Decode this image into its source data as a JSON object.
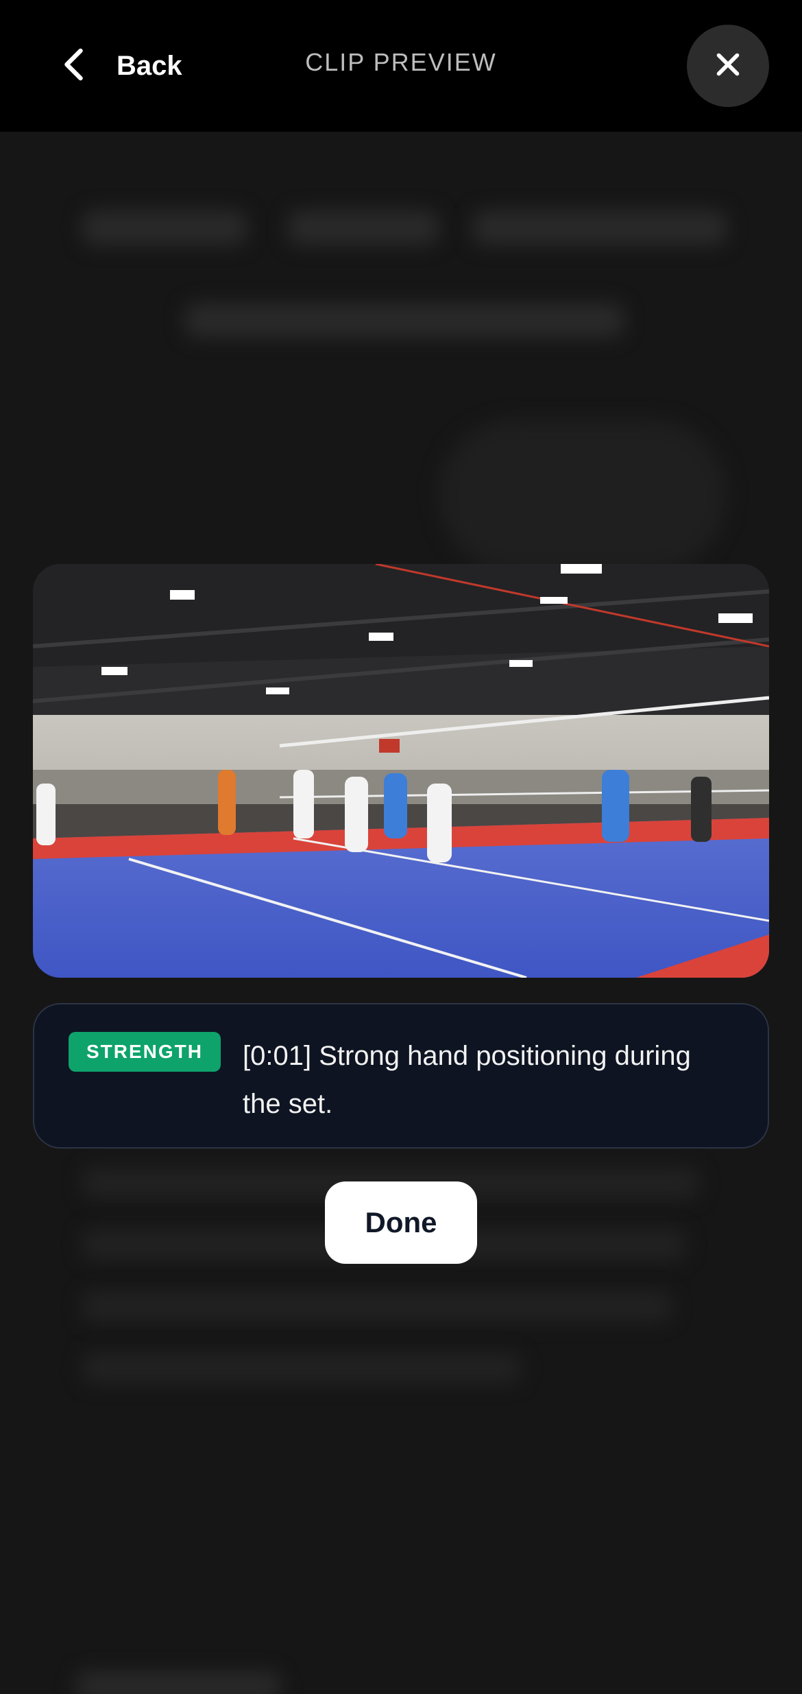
{
  "header": {
    "back_label": "Back",
    "title": "CLIP PREVIEW",
    "back_icon": "chevron-left-icon",
    "close_icon": "close-icon"
  },
  "video": {
    "content": "volleyball-match-frame"
  },
  "feedback": {
    "badge": "STRENGTH",
    "text": "[0:01] Strong hand positioning during the set.",
    "badge_color": "#0fa36c"
  },
  "actions": {
    "done_label": "Done"
  }
}
